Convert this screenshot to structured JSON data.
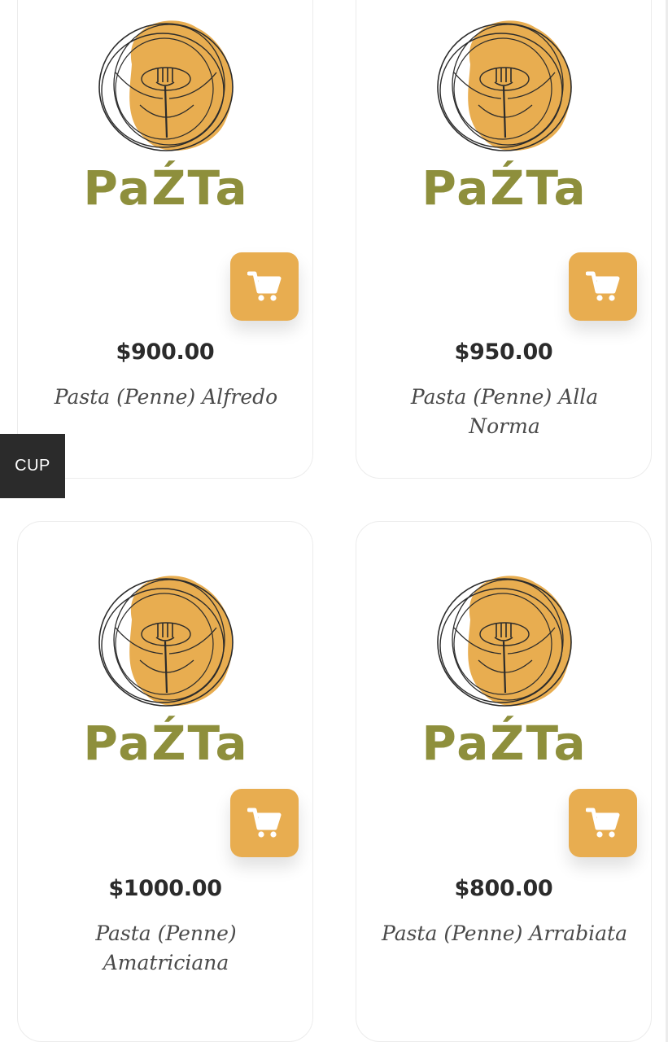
{
  "floating_tab": {
    "label": "CUP"
  },
  "brand": {
    "logo_text": "PaŹTa",
    "logo_color": "#8e8f3c",
    "accent": "#e8ad50"
  },
  "products": [
    {
      "price": "$900.00",
      "name": "Pasta (Penne) Alfredo",
      "image": "pazta-logo"
    },
    {
      "price": "$950.00",
      "name": "Pasta (Penne) Alla Norma",
      "image": "pazta-logo"
    },
    {
      "price": "$1000.00",
      "name": "Pasta (Penne) Amatriciana",
      "image": "pazta-logo"
    },
    {
      "price": "$800.00",
      "name": "Pasta (Penne) Arrabiata",
      "image": "pazta-logo"
    }
  ],
  "icons": {
    "cart": "shopping-cart-icon"
  }
}
